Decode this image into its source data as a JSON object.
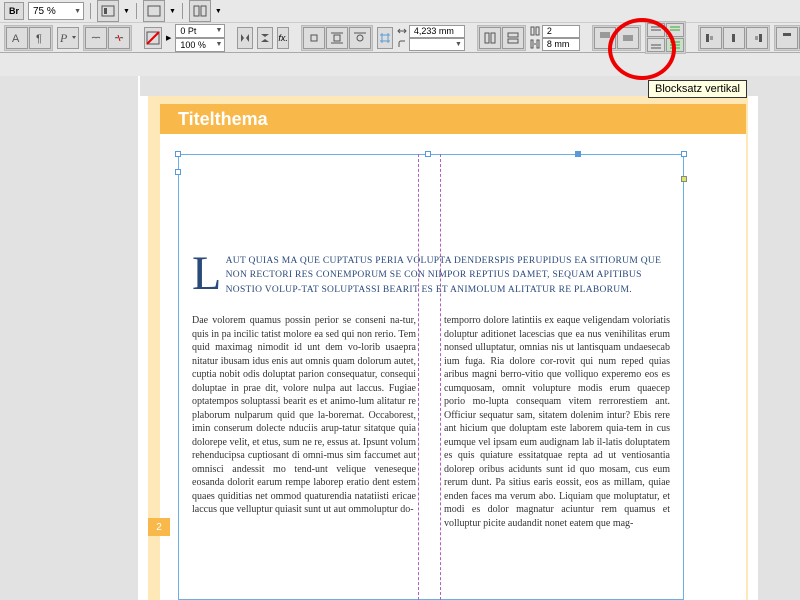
{
  "toolbar_top": {
    "br": "Br",
    "zoom": "75 %"
  },
  "toolbar_main": {
    "stroke_pt": "0 Pt",
    "scale": "100 %",
    "width_mm": "4,233 mm",
    "cols": "2",
    "gutter": "8 mm"
  },
  "tooltip": "Blocksatz vertikal",
  "page": {
    "header": "Titelthema",
    "page_number": "2",
    "lead_dropcap": "L",
    "lead_text": "AUT QUIAS MA QUE CUPTATUS PERIA VOLUPTA DENDERSPIS PERUPIDUS EA SITIORUM QUE NON RECTORI RES CONEMPORUM SE CON NIMPOR REPTIUS DAMET, SEQUAM APITIBUS NOSTIO VOLUP-TAT SOLUPTASSI BEARIT ES ET ANIMOLUM ALITATUR RE PLABORUM.",
    "col1": "Dae volorem quamus possin perior se conseni na-tur, quis in pa incilic tatist molore ea sed qui non rerio. Tem quid maximag nimodit id unt dem vo-lorib usaepra nitatur ibusam idus enis aut omnis quam dolorum autet, cuptia nobit odis doluptat parion consequatur, consequi doluptae in prae dit, volore nulpa aut laccus.\nFugiae optatempos soluptassi bearit es et animo-lum alitatur re plaborum nulparum quid que la-borernat.\nOccaborest, imin conserum dolecte nduciis arup-tatur sitatque quia dolorepe velit, et etus, sum ne re, essus at.\nIpsunt volum rehenducipsa cuptiosant di omni-mus sim faccumet aut omnisci andessit mo tend-unt velique veneseque eosanda dolorit earum rempe laborep eratio dent estem quaes quiditias net ommod quaturendia natatiisti ericae laccus que velluptur quiasit sunt ut aut ommoluptur do-",
    "col2": "temporro dolore latintiis ex eaque veligendam voloriatis doluptur aditionet lacescias que ea nus venihilitas erum nonsed ulluptatur, omnias nis ut lantisquam undaesecab ium fuga. Ria dolore cor-rovit qui num reped quias aribus magni berro-vitio que volliquo experemo eos es cumquosam, omnit volupture modis erum quaecep porio mo-lupta consequam vitem rerrorestiem ant.\nOfficiur sequatur sam, sitatem dolenim intur? Ebis rere ant hicium que doluptam este laborem quia-tem in cus eumque vel ipsam eum audignam lab il-latis doluptatem es quis quiature essitatquae repta ad ut ventiosantia dolorep oribus acidunts sunt id quo mosam, cus eum rerum dunt.\nPa sitius earis eossit, eos as millam, quiae enden faces ma verum abo. Liquiam que moluptatur, et modi es dolor magnatur aciuntur rem quamus et volluptur picite audandit nonet eatem que mag-"
  }
}
